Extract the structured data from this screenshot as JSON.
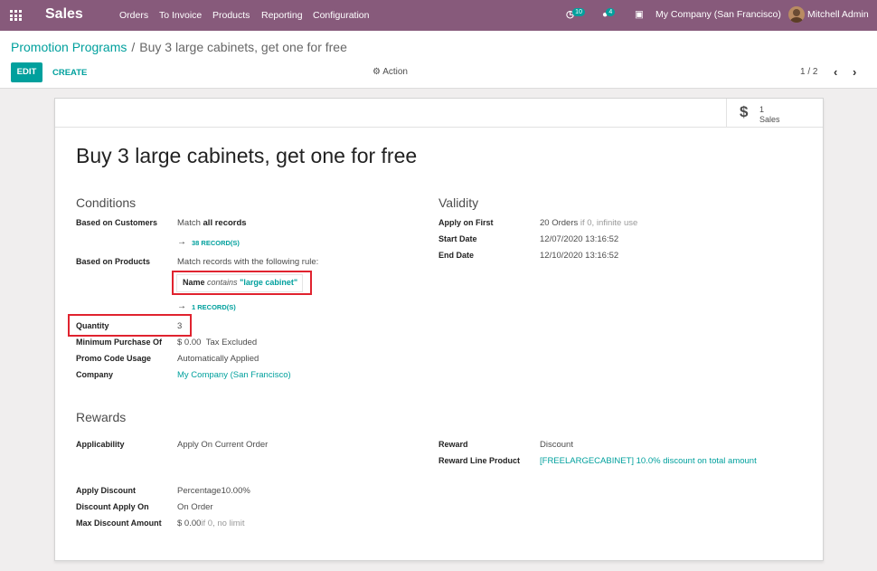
{
  "navbar": {
    "app_name": "Sales",
    "menu": [
      "Orders",
      "To Invoice",
      "Products",
      "Reporting",
      "Configuration"
    ],
    "activity_count": "10",
    "messages_count": "4",
    "company": "My Company (San Francisco)",
    "user": "Mitchell Admin",
    "bg_color": "#875a7b"
  },
  "breadcrumb": {
    "parent": "Promotion Programs",
    "separator": "/",
    "current": "Buy 3 large cabinets, get one for free"
  },
  "toolbar": {
    "edit_label": "EDIT",
    "create_label": "CREATE",
    "action_label": "Action",
    "pager_text": "1 / 2",
    "accent_color": "#00a09d"
  },
  "stat_button": {
    "value": "1",
    "label": "Sales",
    "icon": "dollar-icon"
  },
  "record": {
    "title": "Buy 3 large cabinets, get one for free"
  },
  "conditions": {
    "heading": "Conditions",
    "based_on_customers_label": "Based on Customers",
    "based_on_customers_value_prefix": "Match ",
    "based_on_customers_value_bold": "all records",
    "customers_records_link": "38 RECORD(S)",
    "based_on_products_label": "Based on Products",
    "based_on_products_value": "Match records with the following rule:",
    "rule_field": "Name",
    "rule_operator": "contains",
    "rule_value": "\"large cabinet\"",
    "products_records_link": "1 RECORD(S)",
    "quantity_label": "Quantity",
    "quantity_value": "3",
    "min_purchase_label": "Minimum Purchase Of",
    "min_purchase_value": "$ 0.00",
    "min_purchase_tax": "Tax Excluded",
    "promo_code_label": "Promo Code Usage",
    "promo_code_value": "Automatically Applied",
    "company_label": "Company",
    "company_value": "My Company (San Francisco)"
  },
  "validity": {
    "heading": "Validity",
    "apply_on_first_label": "Apply on First",
    "apply_on_first_value": "20 Orders",
    "apply_on_first_hint": " if 0, infinite use",
    "start_date_label": "Start Date",
    "start_date_value": "12/07/2020 13:16:52",
    "end_date_label": "End Date",
    "end_date_value": "12/10/2020 13:16:52"
  },
  "rewards": {
    "heading": "Rewards",
    "applicability_label": "Applicability",
    "applicability_value": "Apply On Current Order",
    "reward_label": "Reward",
    "reward_value": "Discount",
    "reward_line_product_label": "Reward Line Product",
    "reward_line_product_value": "[FREELARGECABINET] 10.0% discount on total amount",
    "apply_discount_label": "Apply Discount",
    "apply_discount_value": "Percentage10.00%",
    "discount_apply_on_label": "Discount Apply On",
    "discount_apply_on_value": "On Order",
    "max_discount_label": "Max Discount Amount",
    "max_discount_value": "$ 0.00",
    "max_discount_hint": "if 0, no limit"
  }
}
